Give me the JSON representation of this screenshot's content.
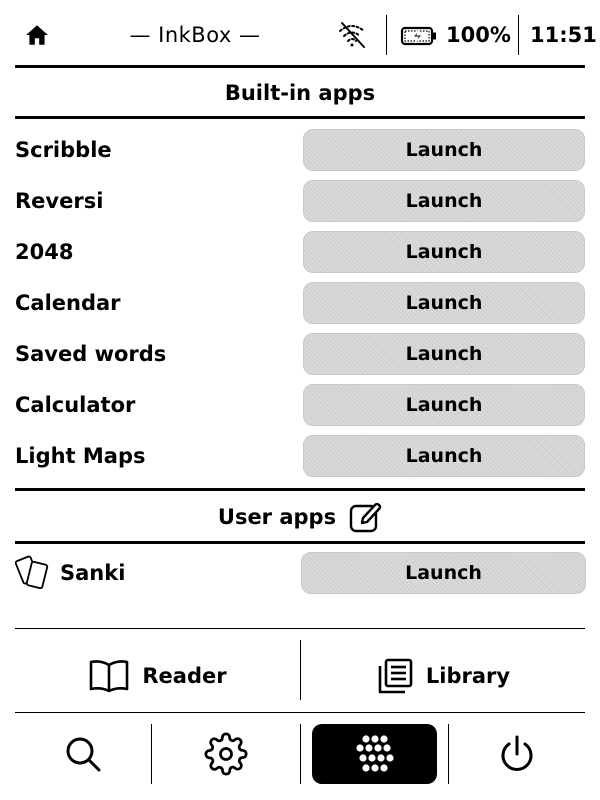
{
  "statusbar": {
    "home_icon": "home-icon",
    "title": "— InkBox —",
    "wifi_icon": "wifi-off-icon",
    "battery_icon": "battery-charging-icon",
    "battery_level": "100%",
    "time": "11:51"
  },
  "builtin": {
    "heading": "Built-in apps",
    "apps": [
      {
        "name": "Scribble",
        "launch": "Launch"
      },
      {
        "name": "Reversi",
        "launch": "Launch"
      },
      {
        "name": "2048",
        "launch": "Launch"
      },
      {
        "name": "Calendar",
        "launch": "Launch"
      },
      {
        "name": "Saved words",
        "launch": "Launch"
      },
      {
        "name": "Calculator",
        "launch": "Launch"
      },
      {
        "name": "Light Maps",
        "launch": "Launch"
      }
    ]
  },
  "user": {
    "heading": "User apps",
    "edit_icon": "edit-icon",
    "apps": [
      {
        "name": "Sanki",
        "launch": "Launch",
        "icon": "cards-icon"
      }
    ]
  },
  "main_buttons": {
    "reader": {
      "label": "Reader",
      "icon": "book-icon"
    },
    "library": {
      "label": "Library",
      "icon": "library-icon"
    }
  },
  "bottom_nav": [
    {
      "icon": "search-icon",
      "active": false
    },
    {
      "icon": "gear-icon",
      "active": false
    },
    {
      "icon": "apps-grid-icon",
      "active": true
    },
    {
      "icon": "power-icon",
      "active": false
    }
  ]
}
